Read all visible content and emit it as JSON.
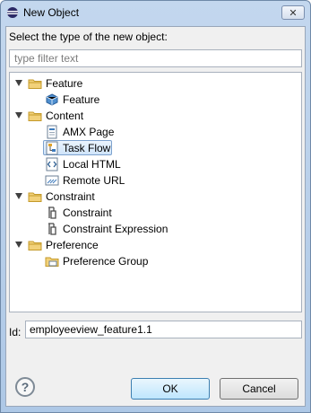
{
  "window": {
    "title": "New Object",
    "close_glyph": "✕"
  },
  "prompt": "Select the type of the new object:",
  "filter": {
    "placeholder": "type filter text",
    "value": ""
  },
  "tree": [
    {
      "label": "Feature",
      "icon": "folder-icon",
      "level": 0,
      "expanded": true
    },
    {
      "label": "Feature",
      "icon": "feature-icon",
      "level": 1
    },
    {
      "label": "Content",
      "icon": "folder-icon",
      "level": 0,
      "expanded": true
    },
    {
      "label": "AMX Page",
      "icon": "amx-page-icon",
      "level": 1
    },
    {
      "label": "Task Flow",
      "icon": "task-flow-icon",
      "level": 1,
      "selected": true
    },
    {
      "label": "Local HTML",
      "icon": "html-icon",
      "level": 1
    },
    {
      "label": "Remote URL",
      "icon": "remote-url-icon",
      "level": 1
    },
    {
      "label": "Constraint",
      "icon": "folder-icon",
      "level": 0,
      "expanded": true
    },
    {
      "label": "Constraint",
      "icon": "constraint-icon",
      "level": 1
    },
    {
      "label": "Constraint Expression",
      "icon": "constraint-icon",
      "level": 1
    },
    {
      "label": "Preference",
      "icon": "folder-icon",
      "level": 0,
      "expanded": true
    },
    {
      "label": "Preference Group",
      "icon": "preference-group-icon",
      "level": 1
    }
  ],
  "id_field": {
    "label": "Id:",
    "value": "employeeview_feature1.1"
  },
  "buttons": {
    "help": "?",
    "ok": "OK",
    "cancel": "Cancel"
  },
  "colors": {
    "selection": "#cfe4fa",
    "folder": "#e8c26a",
    "title_bar": "#c3d7ee"
  }
}
